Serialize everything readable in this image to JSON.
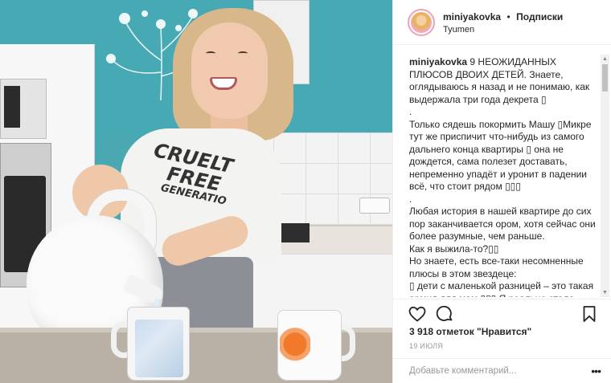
{
  "post": {
    "username": "miniyakovka",
    "separator": "•",
    "follow_label": "Подписки",
    "location": "Tyumen",
    "caption_lines": [
      "9 НЕОЖИДАННЫХ ПЛЮСОВ ДВОИХ ДЕТЕЙ. Знаете, оглядываюсь я назад и не понимаю, как выдержала три года декрета ▯",
      ".",
      "Только сядешь покормить Машу ▯Микре тут же приспичит что-нибудь из самого дальнего конца квартиры ▯ она не дождется, сама полезет доставать, непременно упадёт и уронит в падении всё, что стоит рядом ▯▯▯",
      ".",
      "Любая история в нашей квартире до сих пор заканчивается ором, хотя сейчас они более разумные, чем раньше.",
      "Как я выжила-то?▯▯",
      "Но знаете, есть все-таки несомненные плюсы в этом звездеце:",
      "▯ дети с маленькой разницей – это такая армия для мам ▯▯▯ Я реально стала"
    ],
    "likes": "3 918 отметок \"Нравится\"",
    "date": "19 ИЮЛЯ",
    "comment_placeholder": "Добавьте комментарий...",
    "more": "•••"
  },
  "photo": {
    "shirt_text": "CRUELTY\nFREE\nGENERATION",
    "description_icon": "photo-woman-kettle"
  },
  "scrollbar": {
    "up": "▲",
    "down": "▼"
  },
  "colors": {
    "wall": "#47a9b4",
    "text": "#262626",
    "muted": "#999999",
    "border": "#efefef"
  }
}
